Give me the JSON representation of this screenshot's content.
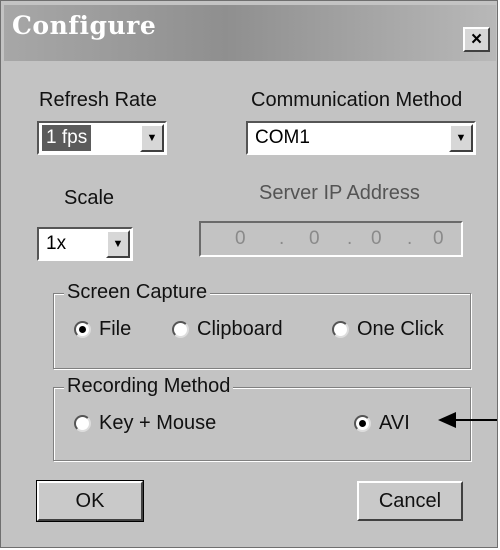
{
  "window": {
    "title": "Configure",
    "close_symbol": "×"
  },
  "refresh_rate": {
    "label": "Refresh Rate",
    "value": "1 fps"
  },
  "communication": {
    "label": "Communication Method",
    "value": "COM1"
  },
  "scale": {
    "label": "Scale",
    "value": "1x"
  },
  "server_ip": {
    "label": "Server IP Address",
    "octets": [
      "0",
      "0",
      "0",
      "0"
    ],
    "separator": "."
  },
  "screen_capture": {
    "legend": "Screen Capture",
    "options": [
      {
        "label": "File",
        "selected": true
      },
      {
        "label": "Clipboard",
        "selected": false
      },
      {
        "label": "One Click",
        "selected": false
      }
    ]
  },
  "recording": {
    "legend": "Recording Method",
    "options": [
      {
        "label": "Key + Mouse",
        "selected": false
      },
      {
        "label": "AVI",
        "selected": true
      }
    ]
  },
  "buttons": {
    "ok": "OK",
    "cancel": "Cancel"
  },
  "colors": {
    "dialog_bg": "#c3c3c3",
    "title_text": "#ffffff"
  },
  "icons": {
    "close": "close-icon",
    "dropdown": "chevron-down-icon",
    "annotation": "arrow-left-icon"
  }
}
